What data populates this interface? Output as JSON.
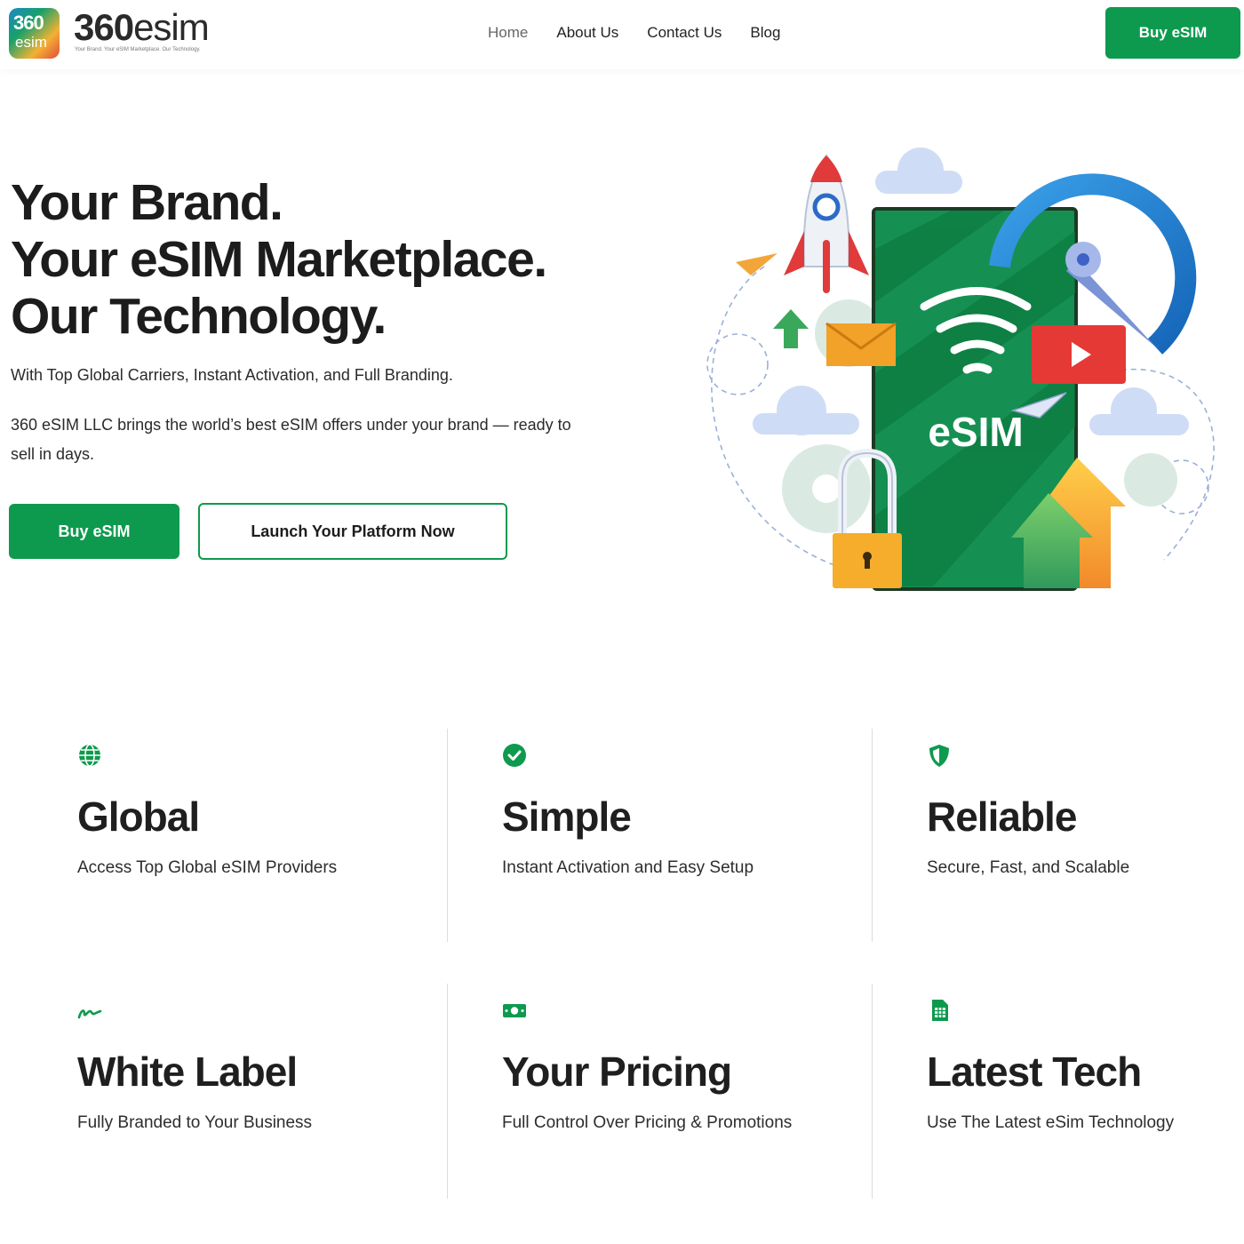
{
  "header": {
    "logo_top": "360",
    "logo_bottom": "esim",
    "brand_bold": "360",
    "brand_rest": "esim",
    "tagline": "Your Brand. Your eSIM Marketplace. Our Technology.",
    "nav": [
      {
        "label": "Home"
      },
      {
        "label": "About Us"
      },
      {
        "label": "Contact Us"
      },
      {
        "label": "Blog"
      }
    ],
    "cta": "Buy eSIM"
  },
  "hero": {
    "title_line1": "Your Brand.",
    "title_line2": "Your eSIM Marketplace.",
    "title_line3": "Our Technology.",
    "subtitle": "With Top Global Carriers, Instant Activation, and Full Branding.",
    "description": "360 eSIM LLC brings the world’s best eSIM offers under your brand — ready to sell in days.",
    "primary_button": "Buy eSIM",
    "secondary_button": "Launch Your Platform Now",
    "illustration_label": "eSIM"
  },
  "features": [
    {
      "icon": "globe-icon",
      "title": "Global",
      "desc": "Access Top Global eSIM Providers"
    },
    {
      "icon": "check-circle-icon",
      "title": "Simple",
      "desc": "Instant Activation and Easy Setup"
    },
    {
      "icon": "shield-icon",
      "title": "Reliable",
      "desc": "Secure, Fast, and Scalable"
    },
    {
      "icon": "signature-icon",
      "title": "White Label",
      "desc": "Fully Branded to Your Business"
    },
    {
      "icon": "money-bill-icon",
      "title": "Your Pricing",
      "desc": "Full Control Over Pricing & Promotions"
    },
    {
      "icon": "sim-card-icon",
      "title": "Latest Tech",
      "desc": "Use The Latest eSim Technology"
    }
  ],
  "colors": {
    "accent": "#0e9a4e",
    "text": "#1f1f1f"
  }
}
